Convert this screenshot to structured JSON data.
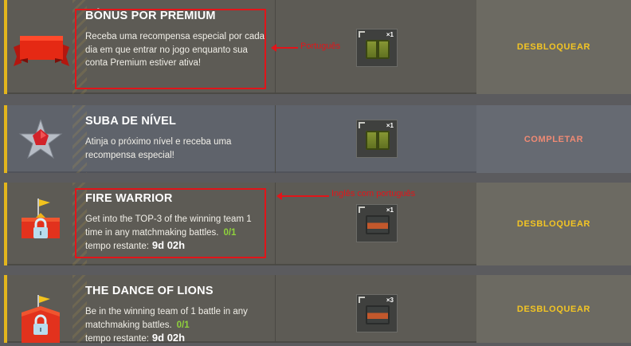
{
  "missions": [
    {
      "title": "BÔNUS POR PREMIUM",
      "description": "Receba uma recompensa especial por cada dia em que entrar no jogo enquanto sua conta Premium estiver ativa!",
      "reward_qty": "×1",
      "action": "DESBLOQUEAR"
    },
    {
      "title": "SUBA DE NÍVEL",
      "description": "Atinja o próximo nível e receba uma recompensa especial!",
      "reward_qty": "×1",
      "action": "COMPLETAR"
    },
    {
      "title": "FIRE WARRIOR",
      "description": "Get into the TOP-3 of the winning team 1 time in any matchmaking battles.",
      "progress": "0/1",
      "time_label": "tempo restante:",
      "time_value": "9d 02h",
      "reward_qty": "×1",
      "action": "DESBLOQUEAR"
    },
    {
      "title": "THE DANCE OF LIONS",
      "description": "Be in the winning team of 1 battle in any matchmaking battles.",
      "progress": "0/1",
      "time_label": "tempo restante:",
      "time_value": "9d 02h",
      "reward_qty": "×3",
      "action": "DESBLOQUEAR"
    }
  ],
  "annotations": {
    "first": "Português",
    "second": "Inglês com português"
  },
  "colors": {
    "accent": "#e3b51d",
    "action_unlock": "#f3c524",
    "action_complete": "#f08a74",
    "progress": "#8fd23c",
    "annotation": "#e1151a"
  },
  "icons": [
    "premium-banner-icon",
    "rank-star-icon",
    "locked-crown-icon",
    "locked-flag-icon",
    "green-crate-icon",
    "orange-crate-icon"
  ]
}
